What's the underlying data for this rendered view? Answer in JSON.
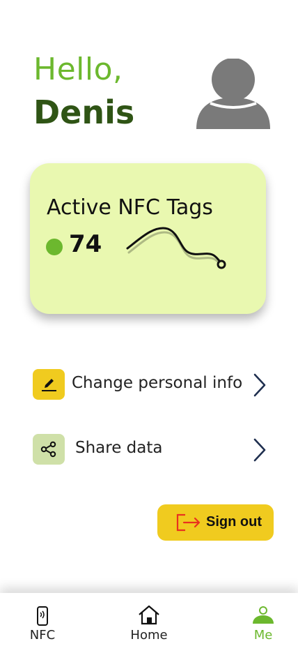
{
  "greeting": {
    "hello": "Hello,",
    "name": "Denis"
  },
  "tags_card": {
    "title": "Active NFC Tags",
    "count": "74"
  },
  "menu": {
    "personal_info_label": "Change personal info",
    "share_label": "Share data"
  },
  "signout": {
    "label": "Sign out"
  },
  "nav": {
    "nfc_label": "NFC",
    "home_label": "Home",
    "me_label": "Me"
  },
  "colors": {
    "accent_green": "#6cb82e",
    "dark_green": "#2f5415",
    "card_bg": "#e9f8b0",
    "yellow": "#f0cb1f",
    "share_bg": "#cfe0a8",
    "chevron": "#1f2f4f"
  }
}
